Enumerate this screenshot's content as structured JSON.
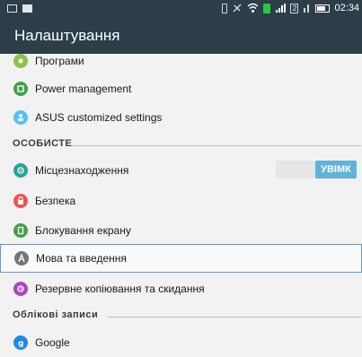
{
  "status_bar": {
    "time": "02:34",
    "sim_label": "2",
    "icons": [
      "notification-icon",
      "image-icon",
      "vibrate-icon",
      "mute-icon",
      "wifi-icon",
      "battery-saver-icon",
      "signal-icon",
      "sim-icon",
      "signal-icon",
      "battery-icon"
    ]
  },
  "app_bar": {
    "title": "Налаштування"
  },
  "items": {
    "programs": {
      "label": "Програми",
      "icon": "apps-icon",
      "color": "#8bc34a"
    },
    "power": {
      "label": "Power management",
      "icon": "power-management-icon",
      "color": "#43a047"
    },
    "asus": {
      "label": "ASUS customized settings",
      "icon": "asus-settings-icon",
      "color": "#4fc3f7"
    },
    "location": {
      "label": "Місцезнаходження",
      "icon": "location-icon",
      "color": "#26a69a"
    },
    "security": {
      "label": "Безпека",
      "icon": "lock-icon",
      "color": "#ef5350"
    },
    "lockscreen": {
      "label": "Блокування екрану",
      "icon": "screen-lock-icon",
      "color": "#43a047"
    },
    "language": {
      "label": "Мова та введення",
      "icon": "language-icon",
      "color": "#757575"
    },
    "backup": {
      "label": "Резервне копіювання та скидання",
      "icon": "backup-icon",
      "color": "#ab47bc"
    },
    "google": {
      "label": "Google",
      "icon": "google-icon",
      "color": "#1e88e5"
    }
  },
  "sections": {
    "personal": "ОСОБИСТЕ",
    "accounts": "Облікові записи"
  },
  "toggle": {
    "location_state": "УВІМК"
  }
}
